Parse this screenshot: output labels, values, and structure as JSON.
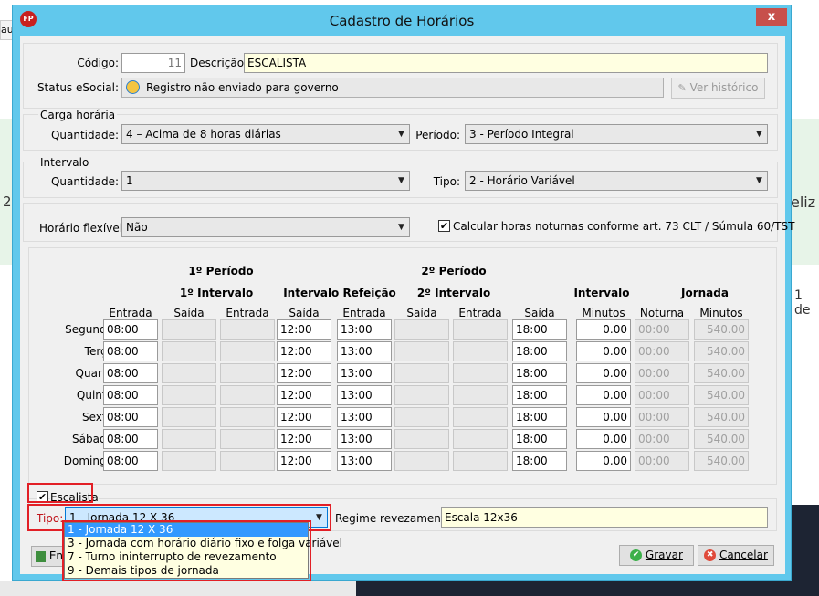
{
  "background": {
    "tab_fragment": "aut",
    "left_char": "2",
    "right_text": "eliz",
    "right_text2": "1 de"
  },
  "window": {
    "title": "Cadastro de Horários",
    "icon": "FP",
    "close_label": "x"
  },
  "header": {
    "codigo_label": "Código:",
    "codigo_value": "11",
    "descricao_label": "Descrição:",
    "descricao_value": "ESCALISTA",
    "status_label": "Status eSocial:",
    "status_value": "Registro não enviado para governo",
    "historico_button": "Ver histórico"
  },
  "carga": {
    "group_label": "Carga horária",
    "quantidade_label": "Quantidade:",
    "quantidade_value": "4 – Acima de 8 horas diárias",
    "periodo_label": "Período:",
    "periodo_value": "3 - Período Integral"
  },
  "intervalo": {
    "group_label": "Intervalo",
    "quantidade_label": "Quantidade:",
    "quantidade_value": "1",
    "tipo_label": "Tipo:",
    "tipo_value": "2 - Horário Variável"
  },
  "flex": {
    "label": "Horário flexível:",
    "value": "Não",
    "noturnas_label": "Calcular horas noturnas conforme art. 73 CLT / Súmula 60/TST",
    "noturnas_checked": true
  },
  "schedule": {
    "periodo1": "1º Período",
    "periodo2": "2º Período",
    "intervalo1": "1º Intervalo",
    "intervalo_refeicao": "Intervalo Refeição",
    "intervalo2": "2º Intervalo",
    "intervalo_group": "Intervalo",
    "jornada_group": "Jornada",
    "columns": [
      "Entrada",
      "Saída",
      "Entrada",
      "Saída",
      "Entrada",
      "Saída",
      "Entrada",
      "Saída",
      "Minutos",
      "Noturna",
      "Minutos"
    ],
    "rows": [
      {
        "day": "Segunda:",
        "c1": "08:00",
        "c4": "12:00",
        "c5": "13:00",
        "c8": "18:00",
        "minutos": "0.00",
        "noturna": "00:00",
        "jornada": "540.00"
      },
      {
        "day": "Terça:",
        "c1": "08:00",
        "c4": "12:00",
        "c5": "13:00",
        "c8": "18:00",
        "minutos": "0.00",
        "noturna": "00:00",
        "jornada": "540.00"
      },
      {
        "day": "Quarta:",
        "c1": "08:00",
        "c4": "12:00",
        "c5": "13:00",
        "c8": "18:00",
        "minutos": "0.00",
        "noturna": "00:00",
        "jornada": "540.00"
      },
      {
        "day": "Quinta:",
        "c1": "08:00",
        "c4": "12:00",
        "c5": "13:00",
        "c8": "18:00",
        "minutos": "0.00",
        "noturna": "00:00",
        "jornada": "540.00"
      },
      {
        "day": "Sexta:",
        "c1": "08:00",
        "c4": "12:00",
        "c5": "13:00",
        "c8": "18:00",
        "minutos": "0.00",
        "noturna": "00:00",
        "jornada": "540.00"
      },
      {
        "day": "Sábado:",
        "c1": "08:00",
        "c4": "12:00",
        "c5": "13:00",
        "c8": "18:00",
        "minutos": "0.00",
        "noturna": "00:00",
        "jornada": "540.00"
      },
      {
        "day": "Domingo:",
        "c1": "08:00",
        "c4": "12:00",
        "c5": "13:00",
        "c8": "18:00",
        "minutos": "0.00",
        "noturna": "00:00",
        "jornada": "540.00"
      }
    ]
  },
  "escalista": {
    "label": "Escalista",
    "checked": true,
    "tipo_label": "Tipo:",
    "tipo_value": "1 - Jornada 12 X 36",
    "regime_label": "Regime revezamento:",
    "regime_value": "Escala 12x36",
    "options": [
      "1 - Jornada 12 X 36",
      "3 - Jornada com horário diário fixo e folga variável",
      "7 - Turno ininterrupto de revezamento",
      "9 - Demais tipos de jornada"
    ]
  },
  "footer": {
    "left_button_fragment": "En",
    "gravar": "Gravar",
    "cancelar": "Cancelar"
  },
  "colors": {
    "title_bar": "#61c8ec",
    "close_button": "#c7504b",
    "yellow_field": "#ffffe1",
    "highlight_red": "#e21f26",
    "selection_blue": "#3399ff"
  }
}
